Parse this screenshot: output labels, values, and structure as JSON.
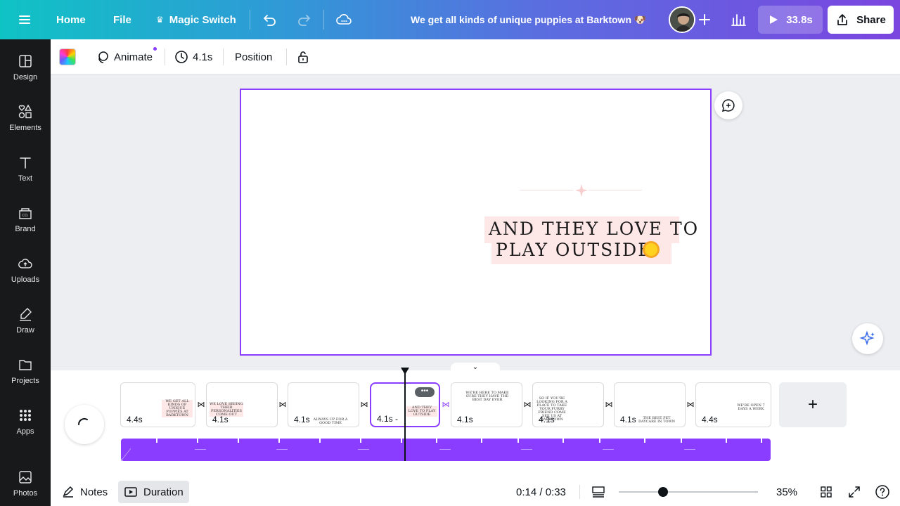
{
  "topbar": {
    "home": "Home",
    "file": "File",
    "magic_switch": "Magic Switch",
    "title": "We get all kinds of unique puppies at Barktown 🐶",
    "play_duration": "33.8s",
    "share": "Share",
    "gradient_start": "#0fc3c5",
    "gradient_end": "#7b45e0"
  },
  "sidebar": {
    "items": [
      {
        "label": "Design",
        "icon": "design-icon"
      },
      {
        "label": "Elements",
        "icon": "elements-icon"
      },
      {
        "label": "Text",
        "icon": "text-icon"
      },
      {
        "label": "Brand",
        "icon": "brand-icon"
      },
      {
        "label": "Uploads",
        "icon": "uploads-icon"
      },
      {
        "label": "Draw",
        "icon": "draw-icon"
      },
      {
        "label": "Projects",
        "icon": "projects-icon"
      },
      {
        "label": "Apps",
        "icon": "apps-icon"
      },
      {
        "label": "Photos",
        "icon": "photos-icon"
      }
    ]
  },
  "toolbar": {
    "animate": "Animate",
    "duration": "4.1s",
    "position": "Position"
  },
  "canvas": {
    "line1": "AND THEY LOVE TO",
    "line2": "PLAY OUTSIDE",
    "accent": "#8b3dff",
    "highlight": "#fde7e7"
  },
  "timeline": {
    "pages": [
      {
        "duration": "4.4s",
        "text": "WE GET ALL KINDS OF UNIQUE PUPPIES AT BARKTOWN"
      },
      {
        "duration": "4.1s",
        "text": "WE LOVE SEEING THEIR PERSONALITIES COME OUT"
      },
      {
        "duration": "4.1s",
        "text": "ALWAYS UP FOR A GOOD TIME"
      },
      {
        "duration": "4.1s -",
        "text": "AND THEY LOVE TO PLAY OUTSIDE"
      },
      {
        "duration": "4.1s",
        "text": "WE'RE HERE TO MAKE SURE THEY HAVE THE BEST DAY EVER"
      },
      {
        "duration": "4.1s",
        "text": "SO IF YOU'RE LOOKING FOR A PLACE TO TAKE YOUR FURRY FRIEND COME SEE US AT BARKTOWN"
      },
      {
        "duration": "4.1s",
        "text": "THE BEST PET DAYCARE IN TOWN"
      },
      {
        "duration": "4.4s",
        "text": "WE'RE OPEN 7 DAYS A WEEK"
      }
    ],
    "add_page": "+"
  },
  "footer": {
    "notes": "Notes",
    "duration": "Duration",
    "time": "0:14 / 0:33",
    "zoom": "35%",
    "zoom_level": 0.35
  }
}
